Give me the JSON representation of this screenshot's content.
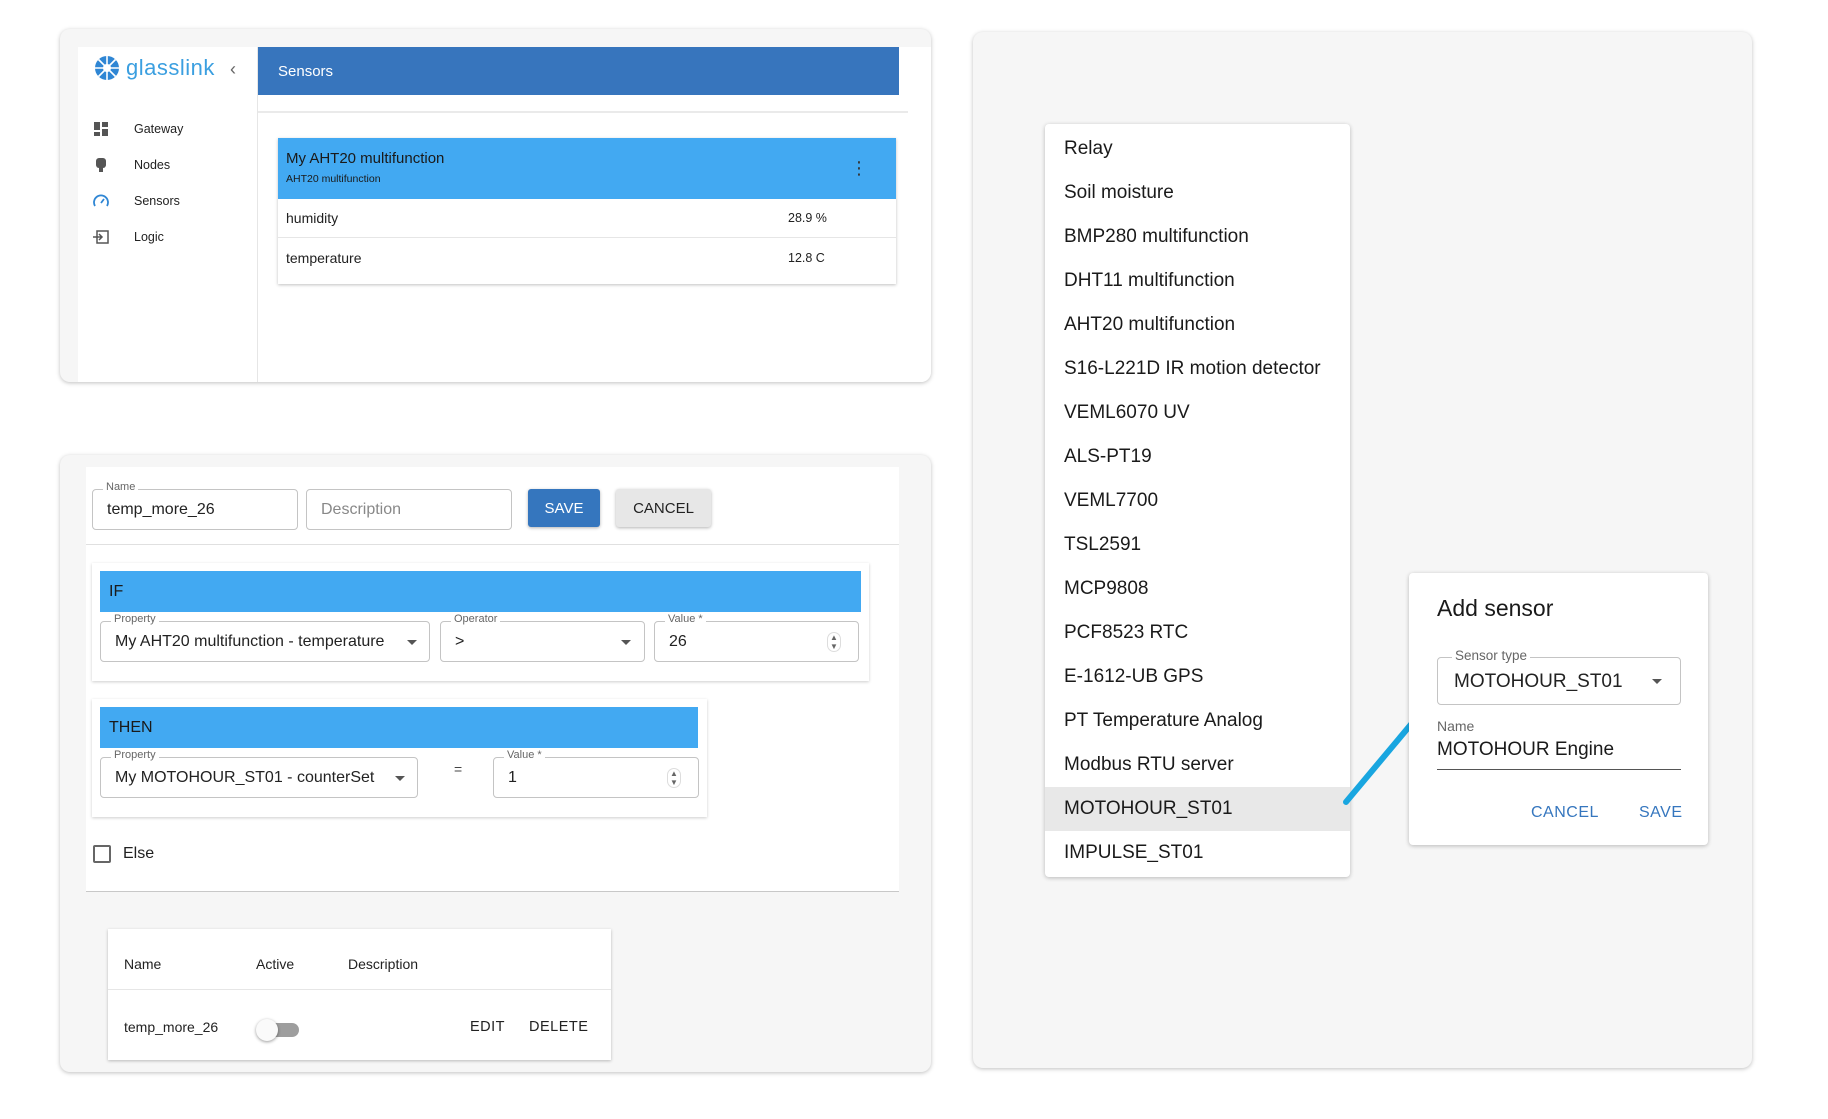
{
  "colors": {
    "appbar": "#3775bd",
    "section_bar": "#42a9f2",
    "primary_button": "#3576be",
    "arrow": "#19a6e0"
  },
  "sensors_app": {
    "brand": "glasslink",
    "collapse_icon": "chevron-left-icon",
    "nav": [
      {
        "label": "Gateway",
        "icon": "dashboard-icon"
      },
      {
        "label": "Nodes",
        "icon": "node-icon"
      },
      {
        "label": "Sensors",
        "icon": "gauge-icon"
      },
      {
        "label": "Logic",
        "icon": "login-icon"
      }
    ],
    "appbar_title": "Sensors",
    "sensor_card": {
      "title": "My AHT20 multifunction",
      "subtitle": "AHT20 multifunction",
      "rows": [
        {
          "name": "humidity",
          "value": "28.9 %"
        },
        {
          "name": "temperature",
          "value": "12.8 C"
        }
      ]
    }
  },
  "logic_editor": {
    "name_field": {
      "label": "Name",
      "value": "temp_more_26"
    },
    "description_field": {
      "placeholder": "Description"
    },
    "save_label": "SAVE",
    "cancel_label": "CANCEL",
    "if_section": {
      "title": "IF",
      "property": {
        "label": "Property",
        "value": "My AHT20 multifunction - temperature"
      },
      "operator": {
        "label": "Operator",
        "value": ">"
      },
      "value": {
        "label": "Value *",
        "value": "26"
      }
    },
    "then_section": {
      "title": "THEN",
      "property": {
        "label": "Property",
        "value": "My MOTOHOUR_ST01 - counterSet"
      },
      "equals": "=",
      "value": {
        "label": "Value *",
        "value": "1"
      }
    },
    "else_label": "Else",
    "else_checked": false,
    "rules_table": {
      "headers": [
        "Name",
        "Active",
        "Description"
      ],
      "rows": [
        {
          "name": "temp_more_26",
          "active": false,
          "edit_label": "EDIT",
          "delete_label": "DELETE"
        }
      ]
    }
  },
  "sensor_types_menu": {
    "items": [
      "Relay",
      "Soil moisture",
      "BMP280 multifunction",
      "DHT11 multifunction",
      "AHT20 multifunction",
      "S16-L221D IR motion detector",
      "VEML6070 UV",
      "ALS-PT19",
      "VEML7700",
      "TSL2591",
      "MCP9808",
      "PCF8523 RTC",
      "E-1612-UB GPS",
      "PT Temperature Analog",
      "Modbus RTU server",
      "MOTOHOUR_ST01",
      "IMPULSE_ST01"
    ],
    "selected": "MOTOHOUR_ST01"
  },
  "add_sensor_dialog": {
    "title": "Add sensor",
    "sensor_type": {
      "label": "Sensor type",
      "value": "MOTOHOUR_ST01"
    },
    "name": {
      "label": "Name",
      "value": "MOTOHOUR Engine"
    },
    "cancel_label": "CANCEL",
    "save_label": "SAVE"
  }
}
